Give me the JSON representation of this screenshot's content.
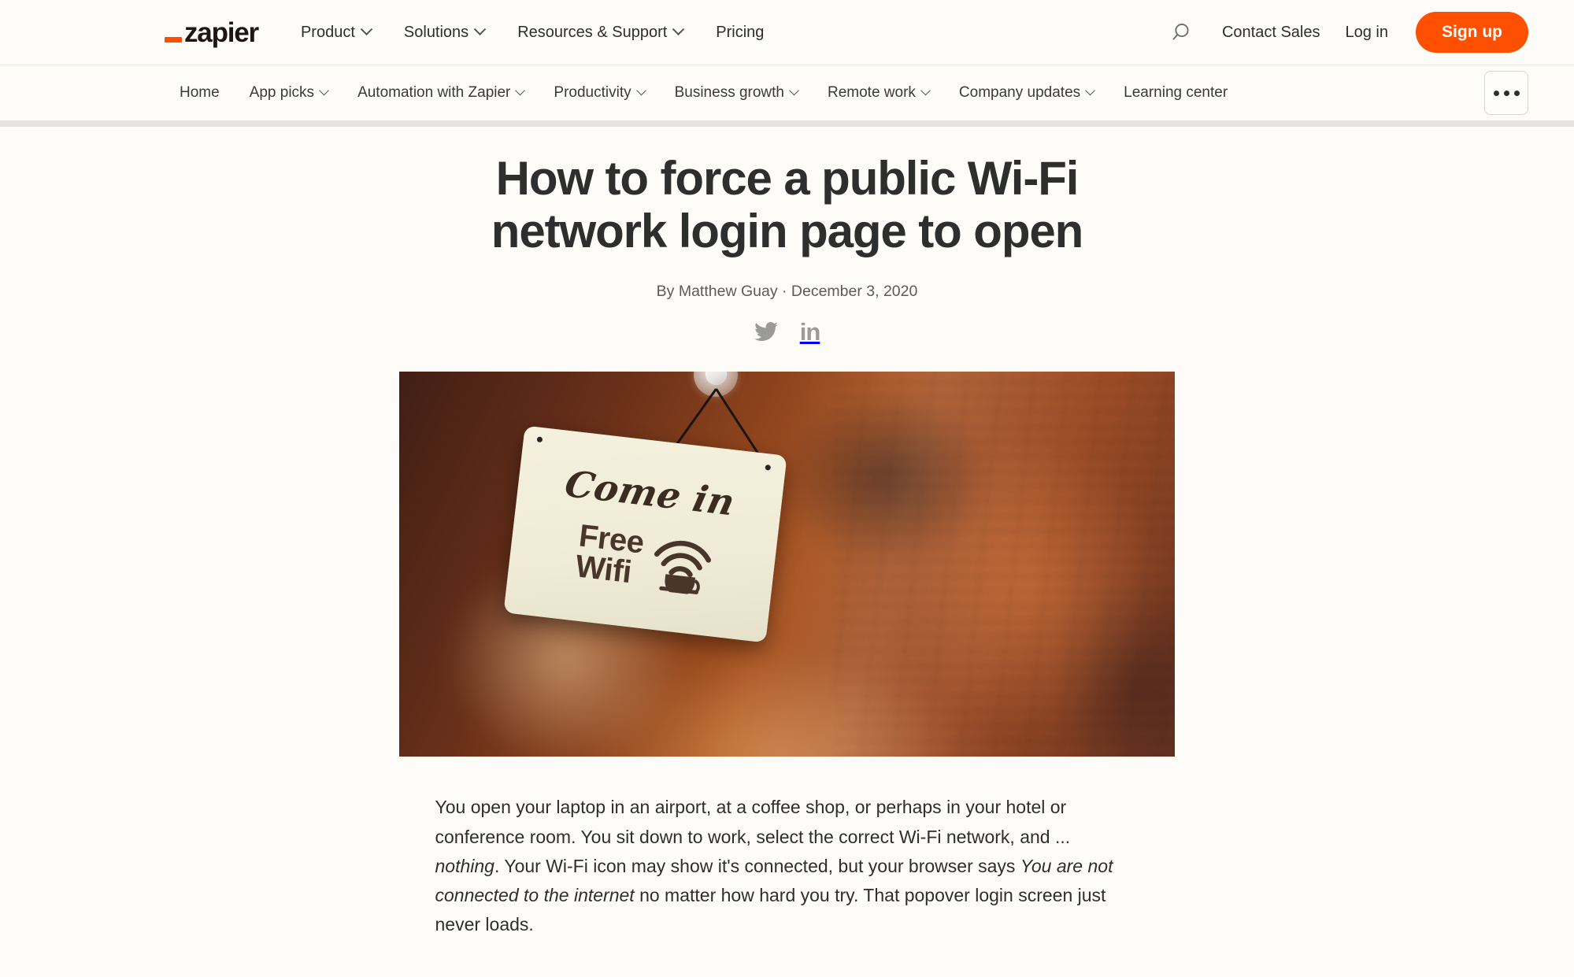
{
  "brand": {
    "logo_text": "zapier",
    "accent_color": "#FF4F00"
  },
  "header": {
    "nav_items": [
      {
        "label": "Product",
        "has_dropdown": true
      },
      {
        "label": "Solutions",
        "has_dropdown": true
      },
      {
        "label": "Resources & Support",
        "has_dropdown": true
      },
      {
        "label": "Pricing",
        "has_dropdown": false
      }
    ],
    "search_icon": "search-icon",
    "contact_sales": "Contact Sales",
    "log_in": "Log in",
    "sign_up": "Sign up"
  },
  "subnav": {
    "items": [
      {
        "label": "Home",
        "has_dropdown": false
      },
      {
        "label": "App picks",
        "has_dropdown": true
      },
      {
        "label": "Automation with Zapier",
        "has_dropdown": true
      },
      {
        "label": "Productivity",
        "has_dropdown": true
      },
      {
        "label": "Business growth",
        "has_dropdown": true
      },
      {
        "label": "Remote work",
        "has_dropdown": true
      },
      {
        "label": "Company updates",
        "has_dropdown": true
      },
      {
        "label": "Learning center",
        "has_dropdown": false
      }
    ],
    "more_button": "overflow-menu"
  },
  "article": {
    "title": "How to force a public Wi-Fi network login page to open",
    "byline": "By Matthew Guay · December 3, 2020",
    "social": [
      {
        "name": "twitter-icon",
        "label": "Twitter"
      },
      {
        "name": "linkedin-icon",
        "label": "in"
      }
    ],
    "hero_image": {
      "alt": "A hanging shop sign in a cafe window reading Come in Free Wifi",
      "sign_line1": "Come in",
      "sign_line2": "Free",
      "sign_line3": "Wifi",
      "sign_icon": "wifi-coffee-cup-icon"
    },
    "paragraph_parts": [
      {
        "type": "text",
        "value": "You open your laptop in an airport, at a coffee shop, or perhaps in your hotel or conference room. You sit down to work, select the correct Wi-Fi network, and ... "
      },
      {
        "type": "em",
        "value": "nothing"
      },
      {
        "type": "text",
        "value": ". Your Wi-Fi icon may show it's connected, but your browser says "
      },
      {
        "type": "em",
        "value": "You are not connected to the internet"
      },
      {
        "type": "text",
        "value": " no matter how hard you try. That popover login screen just never loads."
      }
    ]
  }
}
